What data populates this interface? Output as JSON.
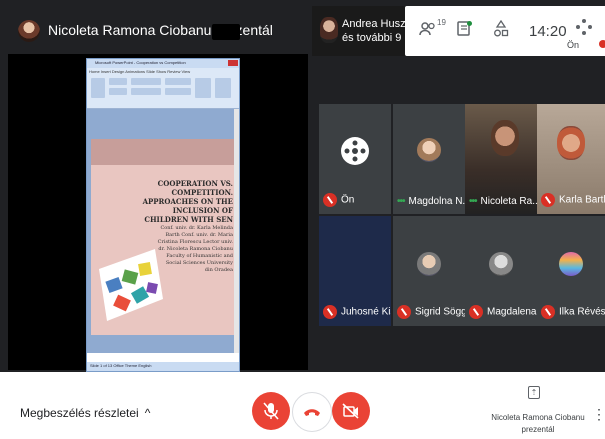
{
  "header": {
    "presenter_title": "Nicoleta Ramona Ciobanu prezentál",
    "participants_pill": {
      "line1": "Andrea Huszár",
      "line2": "és további 9"
    }
  },
  "toolbar": {
    "participant_count": "19",
    "time": "14:20",
    "self_label": "Ön",
    "icons": [
      "people-icon",
      "chat-icon",
      "activities-icon",
      "apps-icon"
    ]
  },
  "shared_screen": {
    "word_title": "Microsoft PowerPoint - Cooperation vs Competition",
    "ribbon_tabs": "Home  Insert  Design  Animations  Slide Show  Review  View",
    "slide_title": "COOPERATION VS. COMPETITION. APPROACHES ON THE INCLUSION OF CHILDREN WITH SEN",
    "slide_authors": "Conf. univ. dr. Karla Melinda Barth Conf. univ. dr. Maria Cristina Florescu Lector univ. dr. Nicoleta Ramona Ciobanu Faculty of Humanistic and Social Sciences University din Oradea",
    "status_text": "Slide 1 of 13  Office Theme  English"
  },
  "participants": [
    {
      "name": "Ön",
      "state": "muted",
      "type": "icon"
    },
    {
      "name": "Magdolna N...",
      "state": "speaking",
      "type": "avatar"
    },
    {
      "name": "Nicoleta Ra...",
      "state": "speaking",
      "type": "video"
    },
    {
      "name": "Karla Barth",
      "state": "muted",
      "type": "video"
    },
    {
      "name": "Juhosné Kis...",
      "state": "muted",
      "type": "blank"
    },
    {
      "name": "Sigrid Söggel",
      "state": "muted",
      "type": "avatar"
    },
    {
      "name": "Magdalena ...",
      "state": "muted",
      "type": "avatar"
    },
    {
      "name": "Ilka Révész",
      "state": "muted",
      "type": "avatar"
    }
  ],
  "bottom": {
    "details_label": "Megbeszélés részletei",
    "presenting_name": "Nicoleta Ramona Ciobanu prezentál"
  },
  "colors": {
    "red": "#ea4335",
    "dark": "#202124",
    "tile": "#3c4043",
    "speaking": "#34a853"
  }
}
